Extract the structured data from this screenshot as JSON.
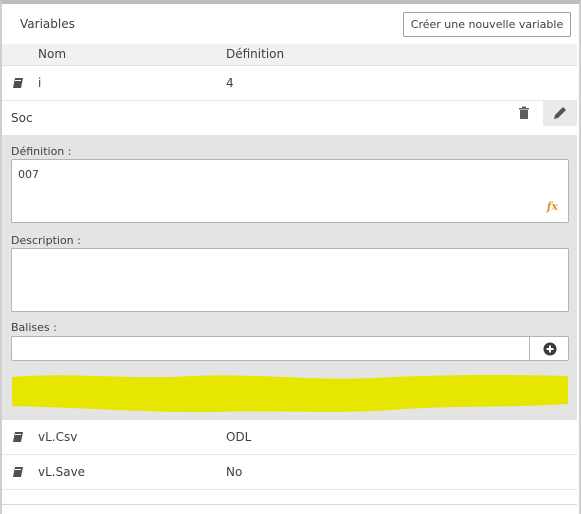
{
  "panel": {
    "title": "Variables",
    "create_button": "Créer une nouvelle variable"
  },
  "columns": {
    "name": "Nom",
    "definition": "Définition"
  },
  "rows_top": [
    {
      "name": "i",
      "definition": "4",
      "icon": "variable-icon"
    }
  ],
  "editor": {
    "variable_name": "Soc",
    "definition_label": "Définition :",
    "definition_value": "007",
    "fx_label": "fx",
    "description_label": "Description :",
    "description_value": "",
    "tags_label": "Balises :",
    "tags_value": "",
    "delete_icon": "trash-icon",
    "edit_icon": "pencil-icon",
    "add_tag_icon": "plus-circle-icon",
    "fx_color": "#e29422",
    "redaction_color": "#e6e600"
  },
  "rows_bottom": [
    {
      "name": "vL.Csv",
      "definition": "ODL",
      "icon": "variable-icon"
    },
    {
      "name": "vL.Save",
      "definition": "No",
      "icon": "variable-icon"
    }
  ]
}
